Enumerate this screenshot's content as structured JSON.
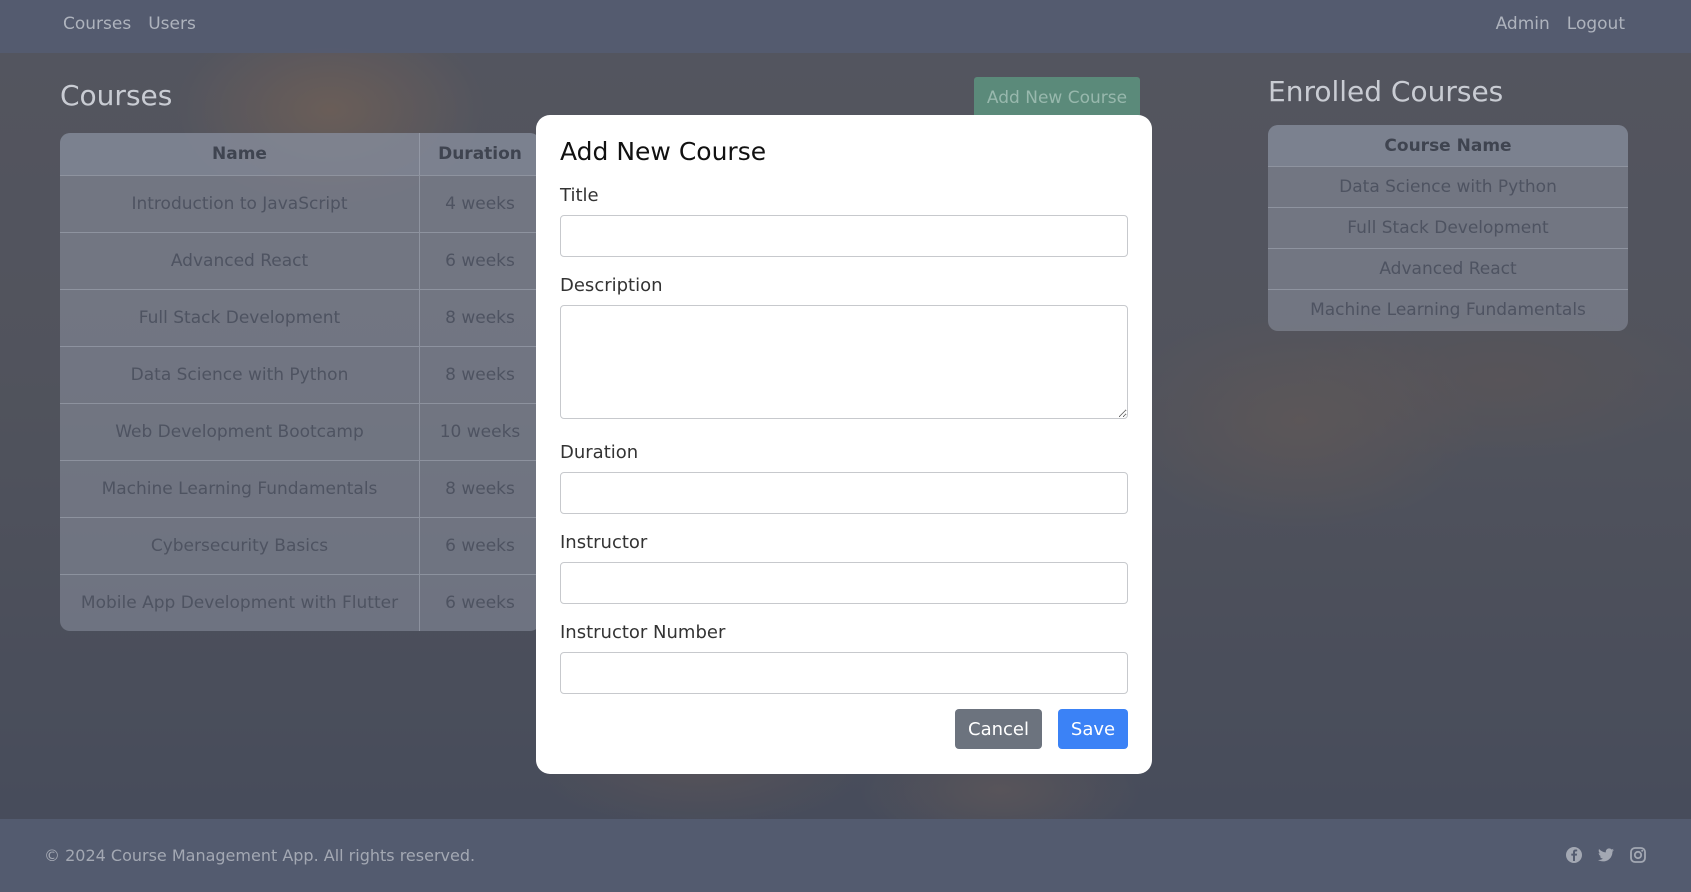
{
  "nav": {
    "left": [
      "Courses",
      "Users"
    ],
    "right": [
      "Admin",
      "Logout"
    ]
  },
  "courses": {
    "title": "Courses",
    "add_button": "Add New Course",
    "columns": [
      "Name",
      "Duration"
    ],
    "rows": [
      [
        "Introduction to JavaScript",
        "4 weeks"
      ],
      [
        "Advanced React",
        "6 weeks"
      ],
      [
        "Full Stack Development",
        "8 weeks"
      ],
      [
        "Data Science with Python",
        "8 weeks"
      ],
      [
        "Web Development Bootcamp",
        "10 weeks"
      ],
      [
        "Machine Learning Fundamentals",
        "8 weeks"
      ],
      [
        "Cybersecurity Basics",
        "6 weeks"
      ],
      [
        "Mobile App Development with Flutter",
        "6 weeks"
      ]
    ]
  },
  "enrolled": {
    "title": "Enrolled Courses",
    "column": "Course Name",
    "rows": [
      "Data Science with Python",
      "Full Stack Development",
      "Advanced React",
      "Machine Learning Fundamentals"
    ]
  },
  "modal": {
    "title": "Add New Course",
    "fields": {
      "title_label": "Title",
      "title_value": "",
      "description_label": "Description",
      "description_value": "",
      "duration_label": "Duration",
      "duration_value": "",
      "instructor_label": "Instructor",
      "instructor_value": "",
      "instructor_number_label": "Instructor Number",
      "instructor_number_value": ""
    },
    "cancel": "Cancel",
    "save": "Save"
  },
  "footer": {
    "text": "© 2024 Course Management App. All rights reserved.",
    "icons": [
      "facebook-icon",
      "twitter-icon",
      "instagram-icon"
    ]
  },
  "colors": {
    "save": "#3b82f6",
    "cancel": "#6c737e",
    "add": "#5b8a7a"
  }
}
